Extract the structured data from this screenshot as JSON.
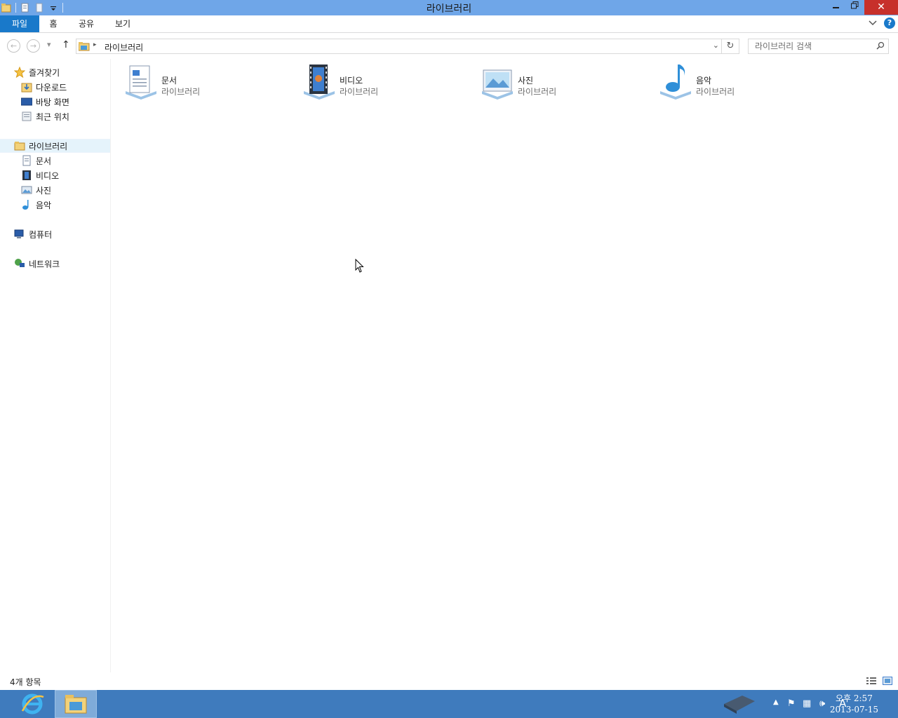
{
  "window": {
    "title": "라이브러리"
  },
  "ribbon": {
    "tabs": [
      "파일",
      "홈",
      "공유",
      "보기"
    ],
    "help": "?"
  },
  "address": {
    "crumb": "라이브러리",
    "search_placeholder": "라이브러리 검색"
  },
  "navpane": {
    "favorites": {
      "label": "즐겨찾기",
      "items": [
        "다운로드",
        "바탕 화면",
        "최근 위치"
      ]
    },
    "libraries": {
      "label": "라이브러리",
      "items": [
        "문서",
        "비디오",
        "사진",
        "음악"
      ]
    },
    "computer": "컴퓨터",
    "network": "네트워크"
  },
  "content": {
    "tiles": [
      {
        "name": "문서",
        "type": "라이브러리",
        "icon": "documents-library-icon"
      },
      {
        "name": "비디오",
        "type": "라이브러리",
        "icon": "videos-library-icon"
      },
      {
        "name": "사진",
        "type": "라이브러리",
        "icon": "pictures-library-icon"
      },
      {
        "name": "음악",
        "type": "라이브러리",
        "icon": "music-library-icon"
      }
    ]
  },
  "statusbar": {
    "count": "4개 항목"
  },
  "taskbar": {
    "clock_time": "오후 2:57",
    "clock_date": "2013-07-15",
    "ime": "A"
  },
  "colors": {
    "titlebar": "#6fa6e8",
    "file_tab": "#1979ca",
    "close": "#c7302b",
    "taskbar": "#3f7bbd",
    "selection": "#e5f3fb"
  }
}
